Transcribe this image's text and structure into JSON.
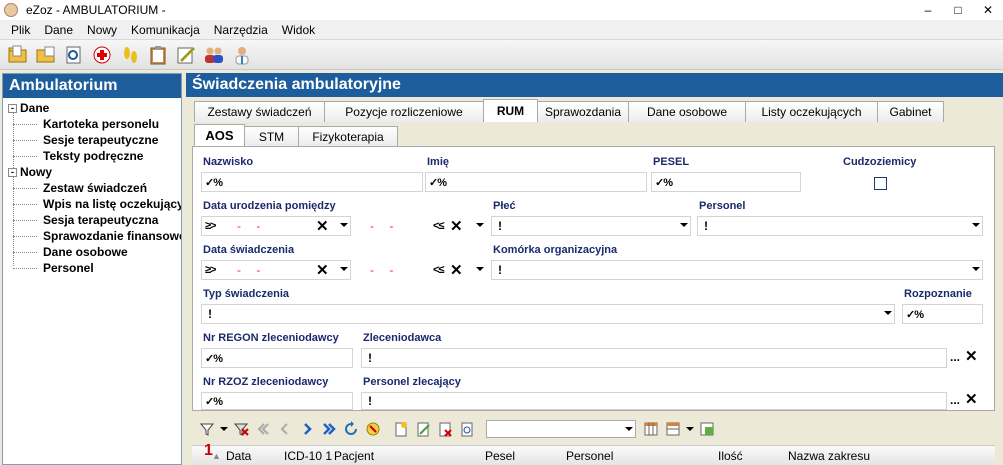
{
  "app": {
    "title": "eZoz - AMBULATORIUM - "
  },
  "menu": [
    "Plik",
    "Dane",
    "Nowy",
    "Komunikacja",
    "Narzędzia",
    "Widok"
  ],
  "toolbar_icons": [
    "open-folder-icon",
    "folder-icon",
    "find-document-icon",
    "medical-cross-icon",
    "footprints-icon",
    "clipboard-icon",
    "edit-pencil-icon",
    "users-icon",
    "doctor-icon"
  ],
  "left": {
    "title": "Ambulatorium",
    "groups": [
      {
        "label": "Dane",
        "expander": "-",
        "items": [
          "Kartoteka personelu",
          "Sesje terapeutyczne",
          "Teksty podręczne"
        ]
      },
      {
        "label": "Nowy",
        "expander": "-",
        "items": [
          "Zestaw świadczeń",
          "Wpis na listę oczekujących",
          "Sesja terapeutyczna",
          "Sprawozdanie finansowe",
          "Dane osobowe",
          "Personel"
        ]
      }
    ]
  },
  "main": {
    "title": "Świadczenia ambulatoryjne",
    "tabs": [
      "Zestawy świadczeń",
      "Pozycje rozliczeniowe",
      "RUM",
      "Sprawozdania",
      "Dane osobowe",
      "Listy oczekujących",
      "Gabinet"
    ],
    "active_tab": "RUM",
    "subtabs": [
      "AOS",
      "STM",
      "Fizykoterapia"
    ],
    "active_subtab": "AOS",
    "form": {
      "nazwisko": "Nazwisko",
      "imie": "Imię",
      "pesel": "PESEL",
      "cudzoziemcy": "Cudzoziemicy",
      "data_urodzenia": "Data urodzenia pomiędzy",
      "plec": "Płeć",
      "personel": "Personel",
      "data_swiadczenia": "Data świadczenia",
      "komorka": "Komórka organizacyjna",
      "typ": "Typ świadczenia",
      "rozpoznanie": "Rozpoznanie",
      "nr_regon": "Nr REGON zleceniodawcy",
      "zleceniodawca": "Zleceniodawca",
      "nr_rzoz": "Nr RZOZ zleceniodawcy",
      "personel_zlecajacy": "Personel zlecający",
      "like_op": "✓%",
      "gte_op": "≥>",
      "lte_op": "<≤",
      "date_placeholder": "- -",
      "bang": "!",
      "clear": "✕",
      "ellipsis": "..."
    },
    "grid": {
      "sort_index": "1",
      "columns": [
        "Data",
        "ICD-10 1",
        "Pacjent",
        "Pesel",
        "Personel",
        "Ilość",
        "Nazwa zakresu"
      ]
    }
  },
  "colors": {
    "header_blue": "#1d5d9b",
    "label_navy": "#1a2a6c",
    "date_red": "#e03030"
  }
}
